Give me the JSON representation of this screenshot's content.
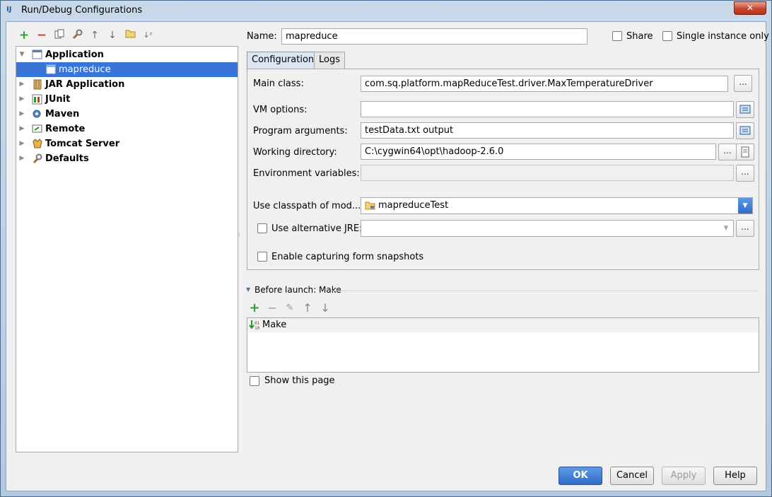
{
  "window": {
    "title": "Run/Debug Configurations",
    "app_icon": "intellij-icon",
    "close_label": "✕"
  },
  "left_toolbar": {
    "add": "+",
    "remove": "−",
    "copy": "copy-icon",
    "edit_defaults": "wrench-icon",
    "move_up": "↑",
    "move_down": "↓",
    "folder": "folder-icon",
    "sort": "sort-az-icon"
  },
  "tree": {
    "items": [
      {
        "label": "Application",
        "expanded": true,
        "icon": "application-icon"
      },
      {
        "label": "mapreduce",
        "selected": true,
        "icon": "application-config-icon"
      },
      {
        "label": "JAR Application",
        "icon": "jar-icon"
      },
      {
        "label": "JUnit",
        "icon": "junit-icon"
      },
      {
        "label": "Maven",
        "icon": "maven-icon"
      },
      {
        "label": "Remote",
        "icon": "remote-icon"
      },
      {
        "label": "Tomcat Server",
        "icon": "tomcat-icon"
      },
      {
        "label": "Defaults",
        "icon": "defaults-icon"
      }
    ]
  },
  "header": {
    "name_label": "Name:",
    "name_value": "mapreduce",
    "share_label": "Share",
    "single_instance_label": "Single instance only"
  },
  "tabs": {
    "configuration": "Configuration",
    "logs": "Logs"
  },
  "config": {
    "main_class_label": "Main class:",
    "main_class_value": "com.sq.platform.mapReduceTest.driver.MaxTemperatureDriver",
    "vm_options_label": "VM options:",
    "vm_options_value": "",
    "program_args_label": "Program arguments:",
    "program_args_value": "testData.txt output",
    "working_dir_label": "Working directory:",
    "working_dir_value": "C:\\cygwin64\\opt\\hadoop-2.6.0",
    "env_vars_label": "Environment variables:",
    "env_vars_value": "",
    "classpath_label": "Use classpath of mod...",
    "classpath_value": "mapreduceTest",
    "alt_jre_label": "Use alternative JRE:",
    "alt_jre_value": "",
    "snapshots_label": "Enable capturing form snapshots",
    "ellipsis": "..."
  },
  "before_launch": {
    "title": "Before launch: Make",
    "toolbar": {
      "add": "+",
      "remove": "−",
      "edit": "✎",
      "up": "↑",
      "down": "↓"
    },
    "items": [
      {
        "label": "Make",
        "icon": "make-icon"
      }
    ],
    "show_page_label": "Show this page"
  },
  "buttons": {
    "ok": "OK",
    "cancel": "Cancel",
    "apply": "Apply",
    "help": "Help"
  },
  "colors": {
    "selection": "#3875d7",
    "add_green": "#2aa12a",
    "remove_red": "#d33b2c",
    "primary_blue": "#2f6cc6"
  }
}
